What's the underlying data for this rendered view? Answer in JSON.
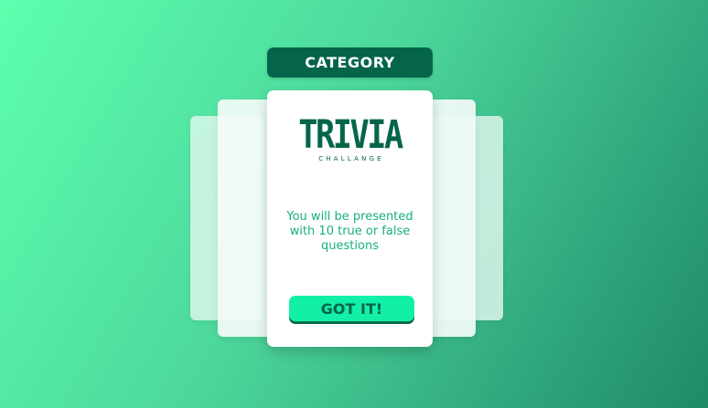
{
  "header": {
    "category_label": "CATEGORY"
  },
  "card": {
    "logo_text": "TRIVIA",
    "logo_subtext": "CHALLANGE",
    "message": "You will be presented with 10 true or false questions",
    "button_label": "GOT IT!"
  },
  "colors": {
    "background_start": "#5effae",
    "background_end": "#1f8a67",
    "brand_dark_green": "#05654a",
    "button_green": "#12f0a8",
    "message_text": "#18b07e"
  }
}
